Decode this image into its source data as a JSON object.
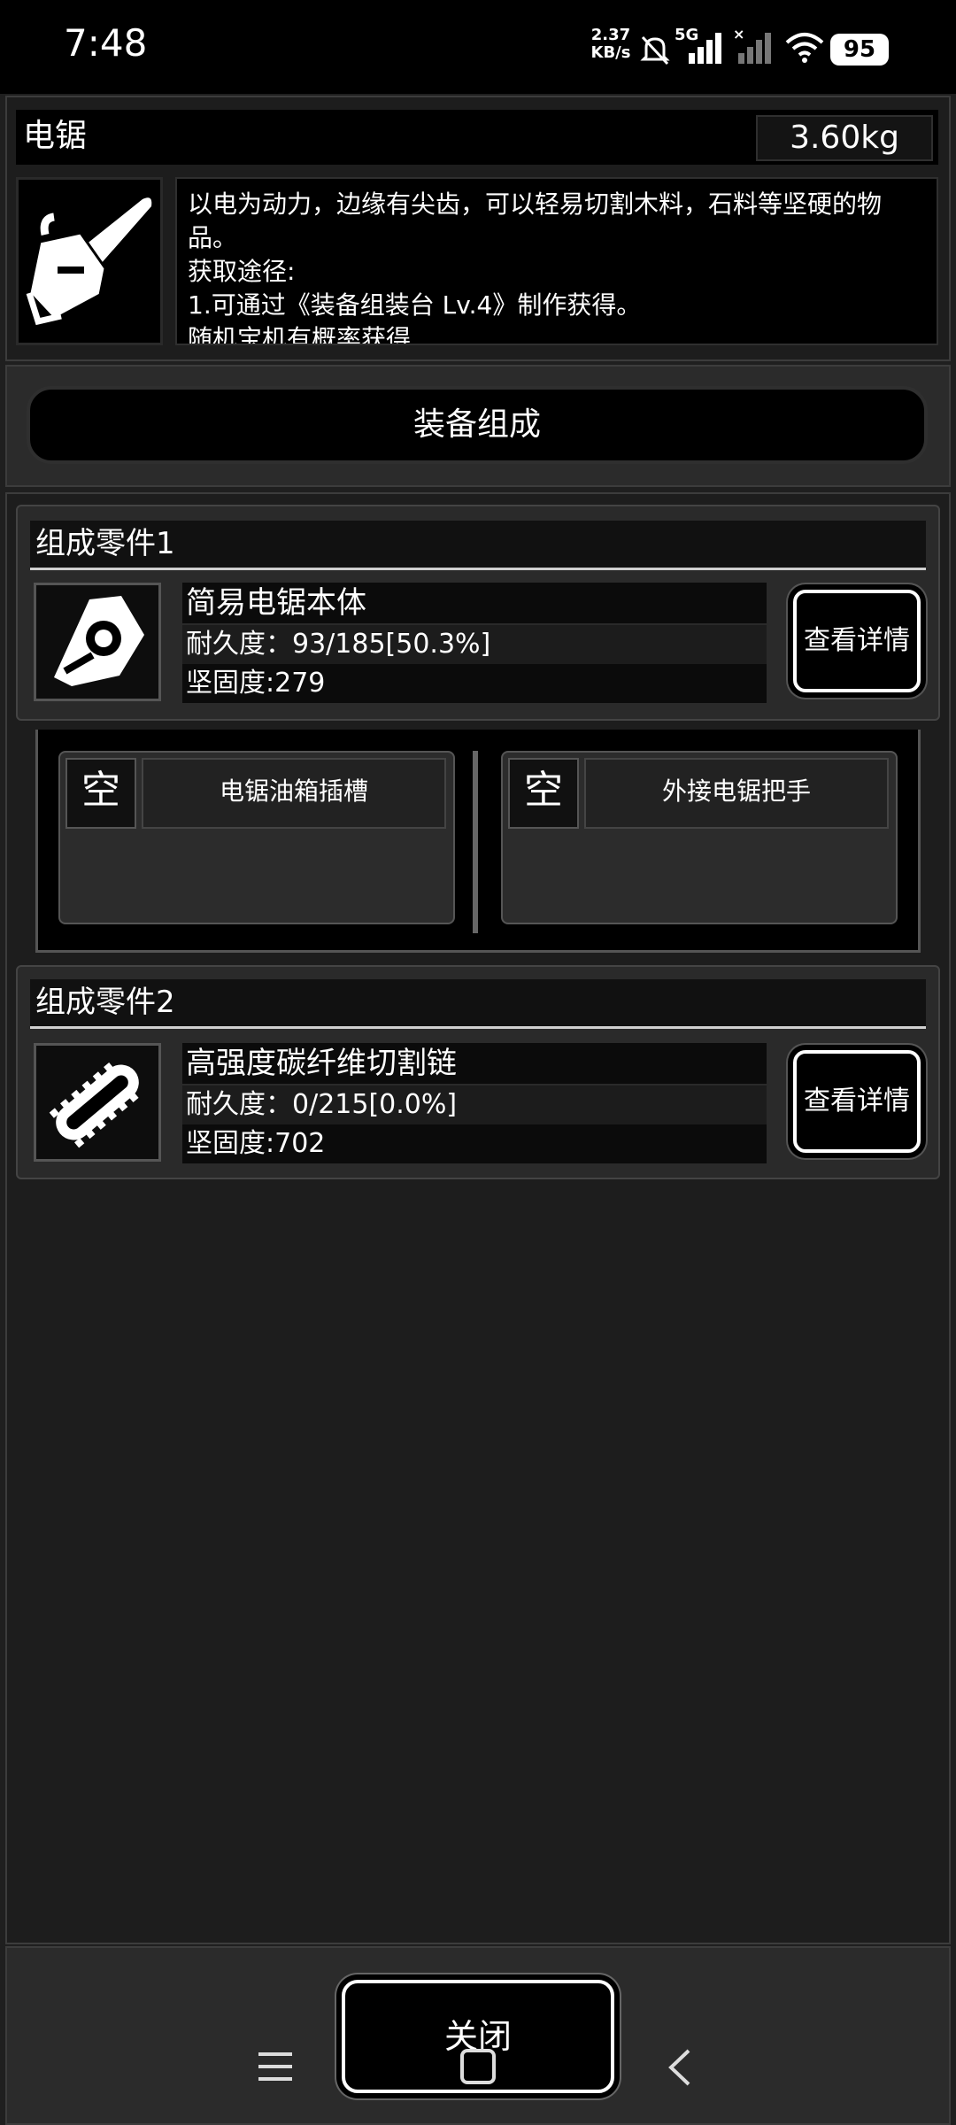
{
  "status_bar": {
    "time": "7:48",
    "net_speed_value": "2.37",
    "net_speed_unit": "KB/s",
    "network_type": "5G",
    "battery": "95"
  },
  "item": {
    "name": "电锯",
    "weight": "3.60kg",
    "description": [
      "以电为动力，边缘有尖齿，可以轻易切割木料，石料等坚硬的物品。",
      "获取途径:",
      "1.可通过《装备组装台 Lv.4》制作获得。",
      "随机宝机有概率获得"
    ],
    "icon": "chainsaw-icon"
  },
  "assemble_button": "装备组成",
  "parts": [
    {
      "header": "组成零件1",
      "name": "简易电锯本体",
      "durability": "耐久度：93/185[50.3%]",
      "hardness": "坚固度:279",
      "detail_button": "查看详情",
      "icon": "chainsaw-body-icon"
    },
    {
      "header": "组成零件2",
      "name": "高强度碳纤维切割链",
      "durability": "耐久度：0/215[0.0%]",
      "hardness": "坚固度:702",
      "detail_button": "查看详情",
      "icon": "chainsaw-chain-icon"
    }
  ],
  "slots": [
    {
      "state": "空",
      "label": "电锯油箱插槽"
    },
    {
      "state": "空",
      "label": "外接电锯把手"
    }
  ],
  "close_button": "关闭"
}
